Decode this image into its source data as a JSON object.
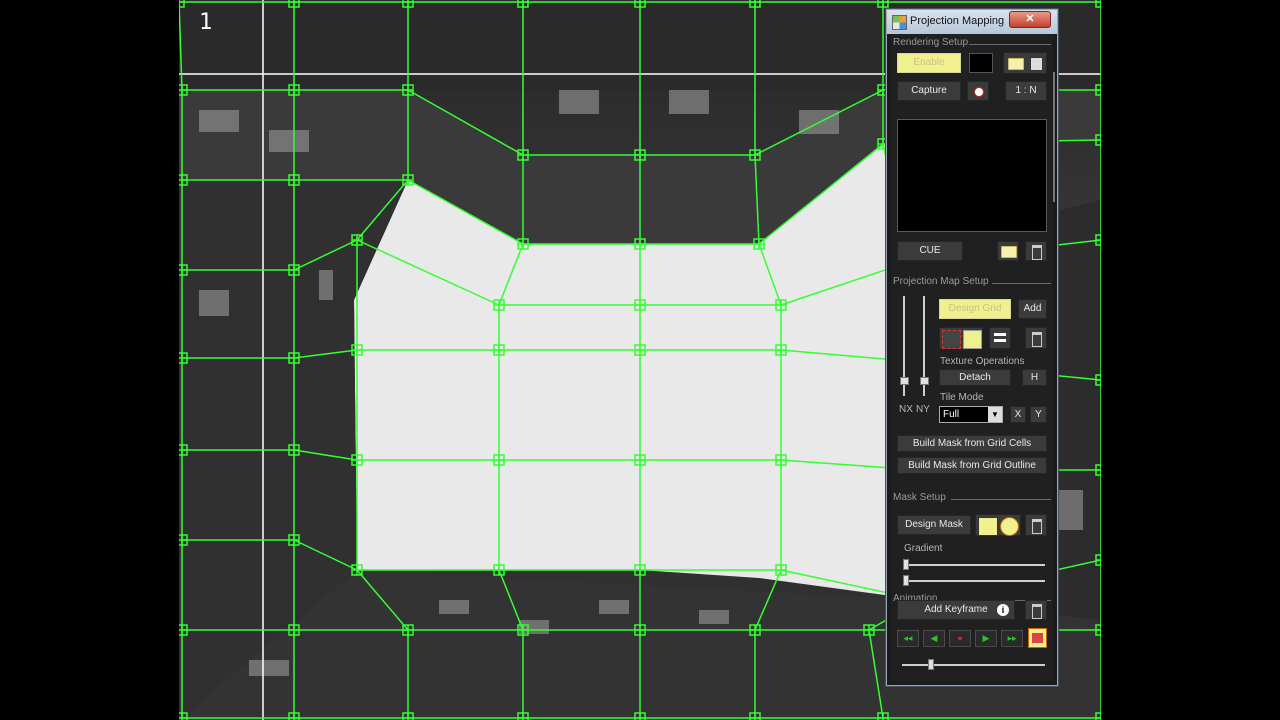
{
  "viewport": {
    "label": "1"
  },
  "window": {
    "title": "Projection Mapping",
    "close_glyph": "✕"
  },
  "rendering_setup": {
    "header": "Rendering Setup",
    "enable_label": "Enable",
    "capture_label": "Capture",
    "ratio_label": "1 : N",
    "cue_label": "CUE"
  },
  "projection_map_setup": {
    "header": "Projection Map Setup",
    "design_grid_label": "Design Grid",
    "add_label": "Add",
    "texture_ops_label": "Texture Operations",
    "detach_label": "Detach",
    "h_label": "H",
    "tile_mode_label": "Tile Mode",
    "tile_mode_value": "Full",
    "x_label": "X",
    "y_label": "Y",
    "nx_label": "NX",
    "ny_label": "NY",
    "build_cells_label": "Build Mask from Grid Cells",
    "build_outline_label": "Build Mask from Grid Outline"
  },
  "mask_setup": {
    "header": "Mask Setup",
    "design_mask_label": "Design Mask",
    "gradient_label": "Gradient"
  },
  "animation": {
    "header": "Animation",
    "add_keyframe_label": "Add Keyframe",
    "info_glyph": "i",
    "transport": [
      "◂◂",
      "◀",
      "●",
      "▶",
      "▸▸"
    ]
  },
  "colors": {
    "grid": "#33ff33",
    "accent_yellow": "#f0f08e",
    "record": "#e02020"
  }
}
